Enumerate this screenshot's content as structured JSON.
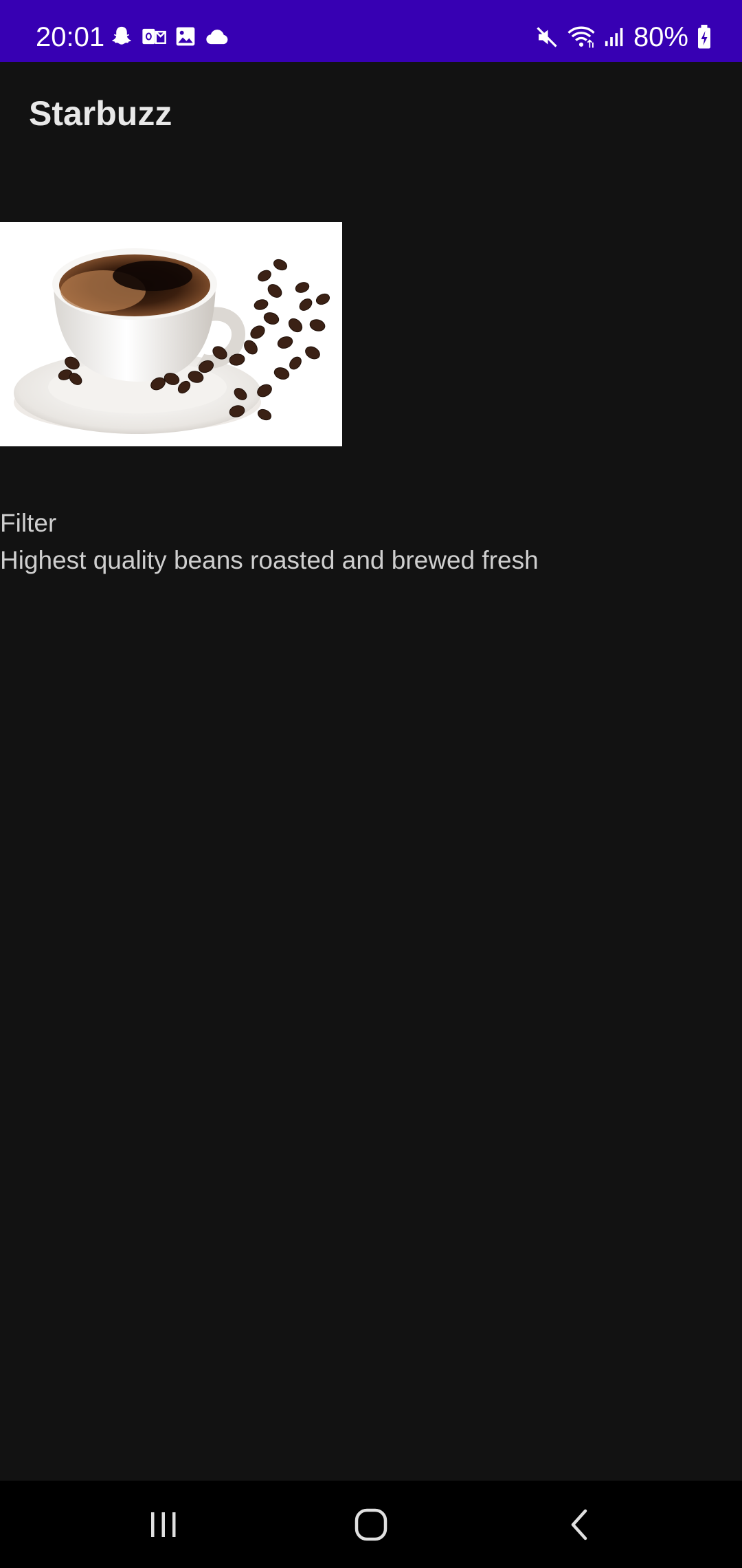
{
  "status_bar": {
    "time": "20:01",
    "battery_percent": "80%",
    "left_icons": [
      "snapchat-icon",
      "outlook-icon",
      "gallery-icon",
      "cloud-icon"
    ],
    "right_icons": [
      "mute-icon",
      "wifi-icon",
      "signal-icon",
      "battery-charging-icon"
    ],
    "background_color": "#3700b3"
  },
  "app_bar": {
    "title": "Starbuzz"
  },
  "drink": {
    "image": "coffee-cup-with-beans",
    "name": "Filter",
    "description": "Highest quality beans roasted and brewed fresh"
  },
  "nav_bar": {
    "buttons": [
      "recent-apps",
      "home",
      "back"
    ]
  }
}
